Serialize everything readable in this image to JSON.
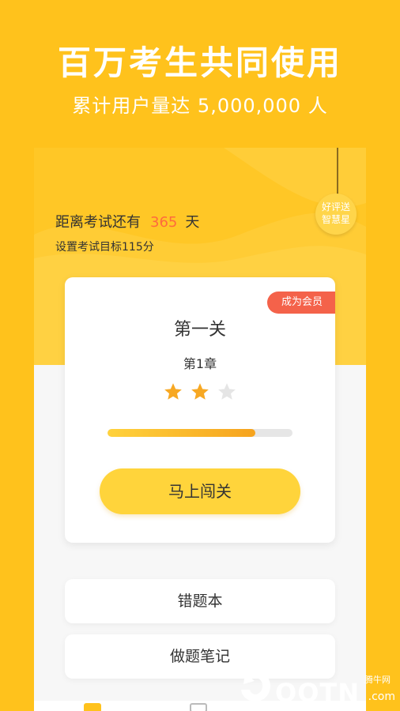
{
  "promo": {
    "headline": "百万考生共同使用",
    "subline": "累计用户量达 5,000,000 人"
  },
  "header": {
    "countdown_prefix": "距离考试还有",
    "countdown_days": "365",
    "countdown_unit": "天",
    "target_text": "设置考试目标115分",
    "review_badge_line1": "好评送",
    "review_badge_line2": "智慧星"
  },
  "level_card": {
    "vip_tag": "成为会员",
    "title": "第一关",
    "chapter": "第1章",
    "stars_filled": 2,
    "stars_total": 3,
    "progress": 0.8,
    "start_button": "马上闯关"
  },
  "menu": {
    "wrong_book": "错题本",
    "notes": "做题笔记"
  },
  "watermark": {
    "brand": "QQTN",
    "small": "腾牛网",
    "suffix": ".com"
  },
  "colors": {
    "background": "#FFC21C",
    "accent_orange": "#FF6A3D",
    "vip_red": "#F4624A",
    "button_yellow": "#FFD43B",
    "star_filled": "#F7A823",
    "star_empty": "#E5E5E5"
  }
}
